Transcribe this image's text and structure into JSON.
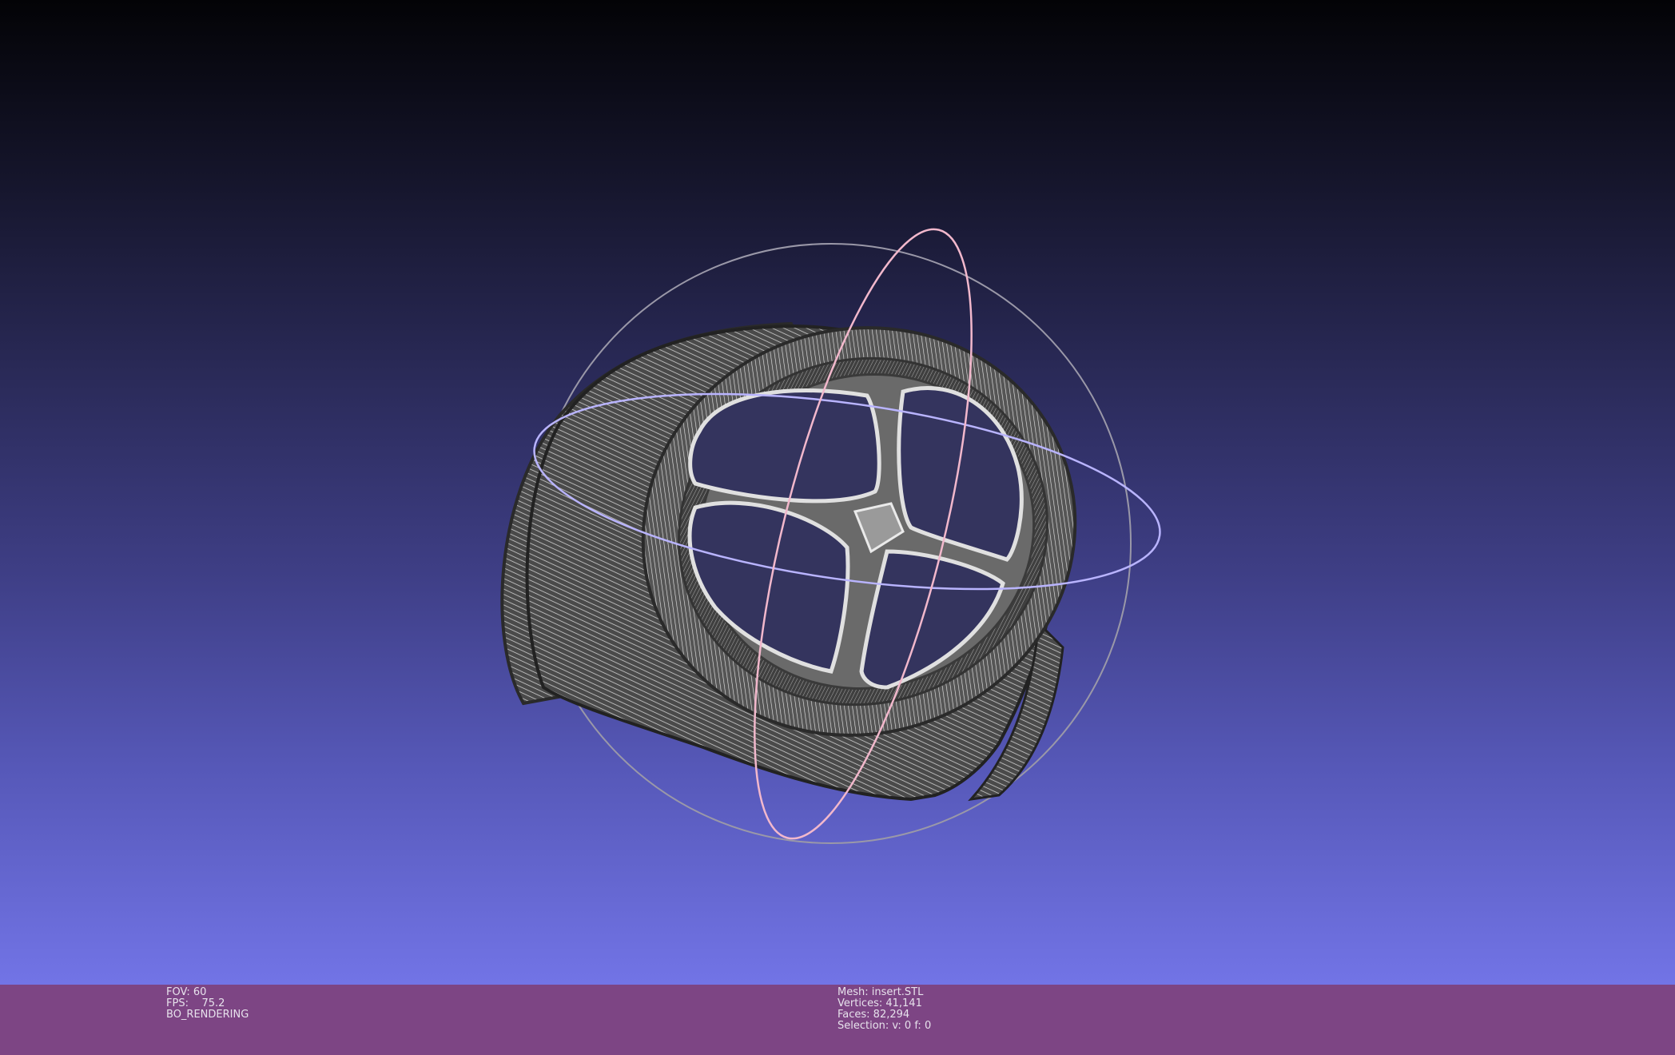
{
  "viewer": {
    "background_top": "#030306",
    "background_bottom": "#7274e6",
    "mesh_fill": "#5b5b5b",
    "mesh_wire": "#d9d9d9",
    "trackball_colors": {
      "horizontal": "#b9b4ff",
      "vertical": "#f2b8cc",
      "outer": "#9a98a8"
    }
  },
  "status_bar": {
    "color": "#7d4584",
    "left": {
      "fov": "FOV: 60",
      "fps": "FPS:    75.2",
      "mode": "BO_RENDERING"
    },
    "center": {
      "mesh": "Mesh: insert.STL",
      "vertices": "Vertices: 41,141",
      "faces": "Faces: 82,294",
      "selection": "Selection: v: 0 f: 0"
    }
  }
}
